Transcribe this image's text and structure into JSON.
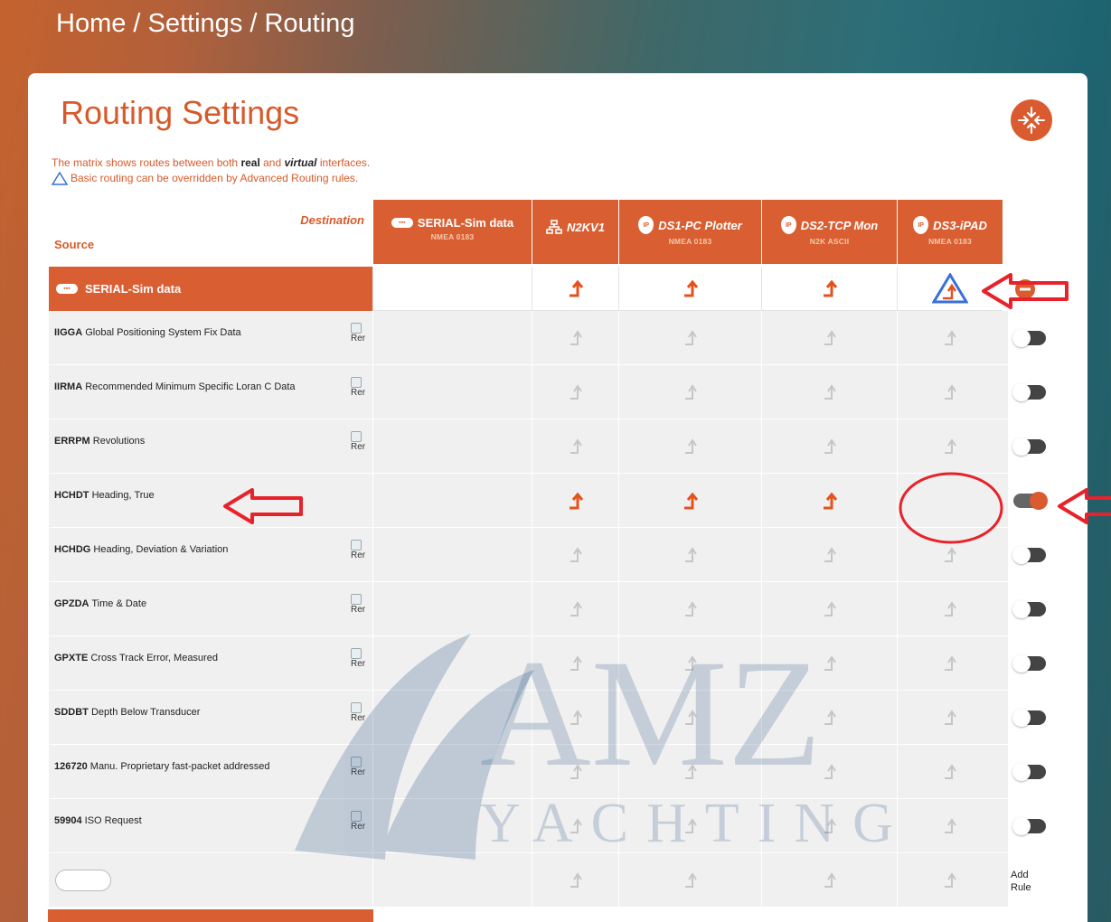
{
  "breadcrumb": "Home / Settings / Routing",
  "title": "Routing Settings",
  "info": {
    "line1_prefix": "The matrix shows routes between both ",
    "line1_real": "real",
    "line1_and": " and ",
    "line1_virtual": "virtual",
    "line1_suffix": " interfaces.",
    "line2": "Basic routing can be overridden by Advanced Routing rules."
  },
  "labels": {
    "destination": "Destination",
    "source": "Source",
    "add_rule": "Add Rule",
    "rer": "Rer"
  },
  "columns": [
    {
      "name": "SERIAL-Sim data",
      "sub": "NMEA 0183",
      "icon": "serial-port-icon"
    },
    {
      "name": "N2KV1",
      "sub": "",
      "icon": "network-icon"
    },
    {
      "name": "DS1-PC Plotter",
      "sub": "NMEA 0183",
      "icon": "ip-pin-icon"
    },
    {
      "name": "DS2-TCP Mon",
      "sub": "N2K ASCII",
      "icon": "ip-pin-icon"
    },
    {
      "name": "DS3-iPAD",
      "sub": "NMEA 0183",
      "icon": "ip-pin-icon"
    }
  ],
  "group": {
    "name": "SERIAL-Sim data",
    "routes": [
      "",
      "active",
      "active",
      "active",
      "override-warning"
    ]
  },
  "rows": [
    {
      "code": "IIGGA",
      "desc": "Global Positioning System Fix Data",
      "rer": true,
      "toggle": false
    },
    {
      "code": "IIRMA",
      "desc": "Recommended Minimum Specific Loran C Data",
      "rer": true,
      "toggle": false
    },
    {
      "code": "ERRPM",
      "desc": "Revolutions",
      "rer": true,
      "toggle": false
    },
    {
      "code": "HCHDT",
      "desc": "Heading, True",
      "rer": false,
      "toggle": true
    },
    {
      "code": "HCHDG",
      "desc": "Heading, Deviation & Variation",
      "rer": true,
      "toggle": false
    },
    {
      "code": "GPZDA",
      "desc": "Time & Date",
      "rer": true,
      "toggle": false
    },
    {
      "code": "GPXTE",
      "desc": "Cross Track Error, Measured",
      "rer": true,
      "toggle": false
    },
    {
      "code": "SDDBT",
      "desc": "Depth Below Transducer",
      "rer": true,
      "toggle": false
    },
    {
      "code": "126720",
      "desc": "Manu. Proprietary fast-packet addressed",
      "rer": true,
      "toggle": false
    },
    {
      "code": "59904",
      "desc": "ISO Request",
      "rer": true,
      "toggle": false
    }
  ],
  "watermark": {
    "main": "AMZ",
    "sub": "YACHTING"
  },
  "colors": {
    "accent": "#d95f33",
    "warning_blue": "#3a6fd8",
    "annotation_red": "#e8222a"
  }
}
